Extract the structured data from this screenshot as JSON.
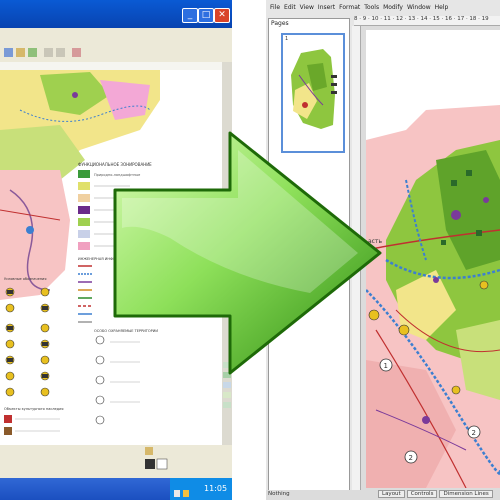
{
  "left_window": {
    "title_buttons": [
      "_",
      "□",
      "✕"
    ],
    "clock": "11:05",
    "legend": [
      "ФУНКЦИОНАЛЬНОЕ ЗОНИРОВАНИЕ",
      "Природно-ландшафтные",
      "ИНЖЕНЕРНАЯ ИНФРАСТРУКТУРА",
      "Условные обозначения",
      "Объекты культурного наследия",
      "ОСОБО ОХРАНЯЕМЫЕ ТЕРРИТОРИИ"
    ]
  },
  "right_window": {
    "menu": [
      "File",
      "Edit",
      "View",
      "Insert",
      "Format",
      "Tools",
      "Modify",
      "Window",
      "Help"
    ],
    "ruler": "8 · 9 · 10 · 11 · 12 · 13 · 14 · 15 · 16 · 17 · 18 · 19",
    "pages_label": "Pages",
    "thumb_number": "1",
    "map_label": "асть",
    "zone_numbers": [
      "1",
      "2",
      "2"
    ],
    "status_text": "Nothing",
    "tabs": [
      "Layout",
      "Controls",
      "Dimension Lines"
    ]
  },
  "colors": {
    "arrow_light": "#b9f08a",
    "arrow_dark": "#2c8a10",
    "xp_blue": "#0a5ad4",
    "map_pink": "#f7c4c4",
    "map_green": "#8ec63f",
    "route_blue": "#3c7fd0"
  }
}
